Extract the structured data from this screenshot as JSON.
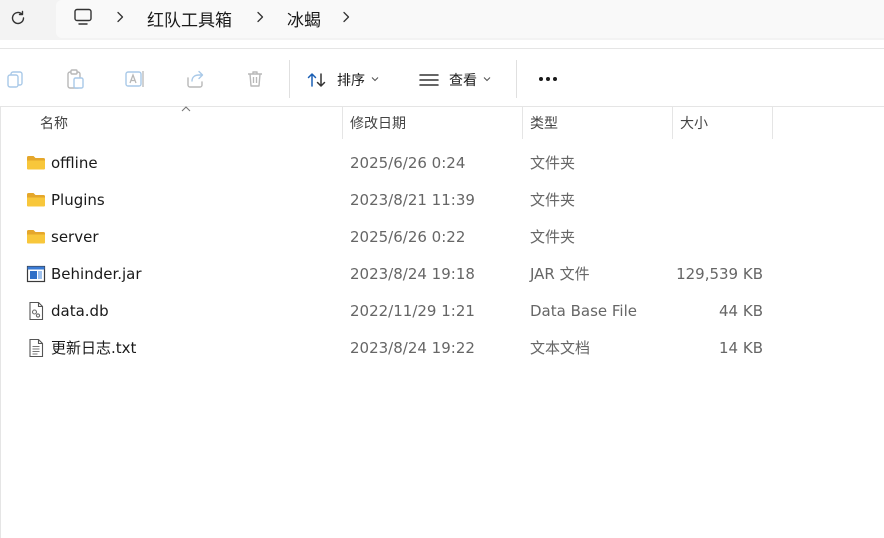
{
  "address": {
    "crumbs": [
      "红队工具箱",
      "冰蝎"
    ]
  },
  "toolbar": {
    "sort_label": "排序",
    "view_label": "查看"
  },
  "columns": {
    "name": "名称",
    "date": "修改日期",
    "type": "类型",
    "size": "大小"
  },
  "files": [
    {
      "name": "offline",
      "date": "2025/6/26 0:24",
      "type": "文件夹",
      "size": "",
      "icon": "folder-icon"
    },
    {
      "name": "Plugins",
      "date": "2023/8/21 11:39",
      "type": "文件夹",
      "size": "",
      "icon": "folder-icon"
    },
    {
      "name": "server",
      "date": "2025/6/26 0:22",
      "type": "文件夹",
      "size": "",
      "icon": "folder-icon"
    },
    {
      "name": "Behinder.jar",
      "date": "2023/8/24 19:18",
      "type": "JAR 文件",
      "size": "129,539 KB",
      "icon": "jar-file-icon"
    },
    {
      "name": "data.db",
      "date": "2022/11/29 1:21",
      "type": "Data Base File",
      "size": "44 KB",
      "icon": "db-file-icon"
    },
    {
      "name": "更新日志.txt",
      "date": "2023/8/24 19:22",
      "type": "文本文档",
      "size": "14 KB",
      "icon": "text-file-icon"
    }
  ],
  "colors": {
    "folder": "#f8c73b",
    "folder_dark": "#e5a72b",
    "toolbar_icon_disabled": "#b8b8b8"
  }
}
